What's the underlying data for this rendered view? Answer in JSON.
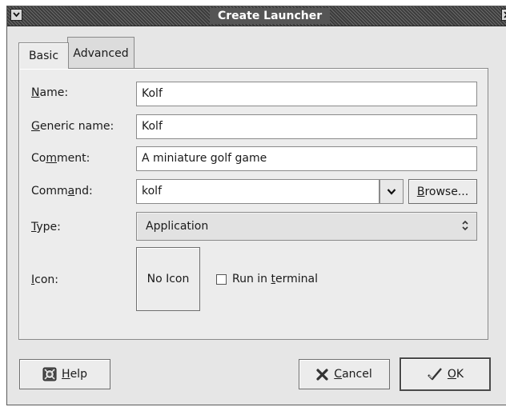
{
  "window": {
    "title": "Create Launcher"
  },
  "tabs": [
    {
      "label": "Basic",
      "active": true
    },
    {
      "label": "Advanced",
      "active": false
    }
  ],
  "form": {
    "name": {
      "label_pre": "",
      "label_mn": "N",
      "label_post": "ame:",
      "value": "Kolf"
    },
    "generic_name": {
      "label_pre": "",
      "label_mn": "G",
      "label_post": "eneric name:",
      "value": "Kolf"
    },
    "comment": {
      "label_pre": "Co",
      "label_mn": "m",
      "label_post": "ment:",
      "value": "A miniature golf game"
    },
    "command": {
      "label_pre": "Comm",
      "label_mn": "a",
      "label_post": "nd:",
      "value": "kolf"
    },
    "browse": {
      "label_pre": "",
      "label_mn": "B",
      "label_post": "rowse..."
    },
    "type": {
      "label_pre": "",
      "label_mn": "T",
      "label_post": "ype:",
      "value": "Application"
    },
    "icon": {
      "label_pre": "",
      "label_mn": "I",
      "label_post": "con:",
      "button_label": "No Icon"
    },
    "run_in_terminal": {
      "label_pre": "Run in ",
      "label_mn": "t",
      "label_post": "erminal",
      "checked": false
    }
  },
  "buttons": {
    "help": {
      "label_pre": "",
      "label_mn": "H",
      "label_post": "elp",
      "icon": "help-icon"
    },
    "cancel": {
      "label_pre": "",
      "label_mn": "C",
      "label_post": "ancel",
      "icon": "cancel-x-icon"
    },
    "ok": {
      "label_pre": "",
      "label_mn": "O",
      "label_post": "K",
      "icon": "checkmark-icon"
    }
  }
}
